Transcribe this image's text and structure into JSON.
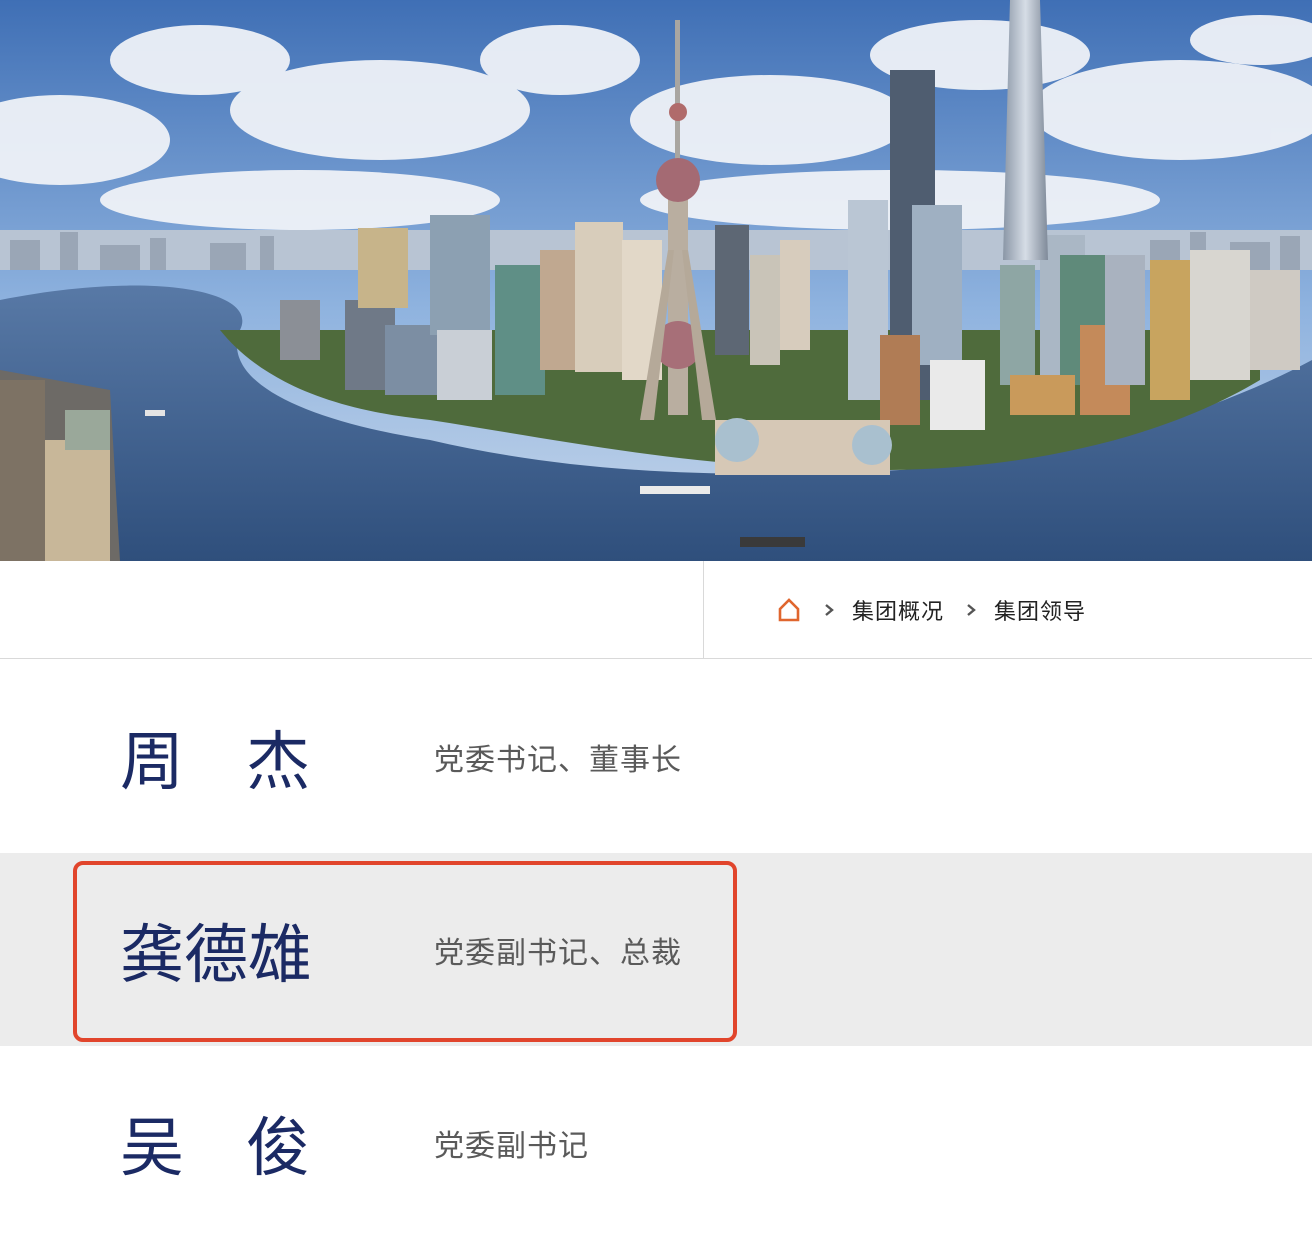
{
  "hero": {
    "icon": "city-skyline-image"
  },
  "breadcrumb": {
    "home_icon": "home-icon",
    "separator_icon": "chevron-right-icon",
    "items": [
      "集团概况",
      "集团领导"
    ],
    "accent_color": "#e0662e"
  },
  "leaders": [
    {
      "name_chars": [
        "周",
        "杰"
      ],
      "title": "党委书记、董事长"
    },
    {
      "name": "龚德雄",
      "title": "党委副书记、总裁"
    },
    {
      "name_chars": [
        "吴",
        "俊"
      ],
      "title": "党委副书记"
    }
  ],
  "colors": {
    "name": "#1b2a64",
    "title": "#5a5a5a",
    "active_row_bg": "#ececec",
    "highlight_border": "#e1452c"
  }
}
